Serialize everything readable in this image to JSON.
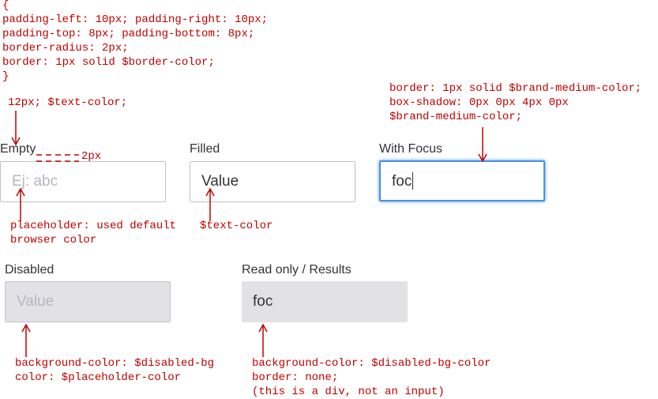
{
  "colors": {
    "annotation": "#c00000",
    "label_text": "#333333",
    "text_color": "#333333",
    "placeholder_color": "#b6b8c0",
    "border_color": "#c2c2c2",
    "brand_medium_color": "#4a90e2",
    "disabled_bg": "#e2e2e6"
  },
  "annotations": {
    "base_style": {
      "lines": [
        "{",
        "padding-left: 10px; padding-right: 10px;",
        "padding-top: 8px; padding-bottom: 8px;",
        "border-radius: 2px;",
        "border: 1px solid $border-color;",
        "}"
      ]
    },
    "label_style": "12px; $text-color;",
    "label_gap": "2px",
    "focus_style": {
      "lines": [
        "border: 1px solid $brand-medium-color;",
        "box-shadow: 0px 0px 4px 0px",
        "$brand-medium-color;"
      ]
    },
    "placeholder_note": {
      "lines": [
        "placeholder: used default",
        "browser color"
      ]
    },
    "filled_note": "$text-color",
    "disabled_note": {
      "lines": [
        "background-color: $disabled-bg",
        "color: $placeholder-color"
      ]
    },
    "readonly_note": {
      "lines": [
        "background-color: $disabled-bg-color",
        "border: none;",
        "(this is a div, not an input)"
      ]
    }
  },
  "states": {
    "empty": {
      "label": "Empty",
      "placeholder": "Ej: abc"
    },
    "filled": {
      "label": "Filled",
      "value": "Value"
    },
    "focus": {
      "label": "With Focus",
      "value": "foc"
    },
    "disabled": {
      "label": "Disabled",
      "value": "Value"
    },
    "readonly": {
      "label": "Read only / Results",
      "value": "foc"
    }
  },
  "icons": {
    "arrow": "red-arrow-icon"
  }
}
